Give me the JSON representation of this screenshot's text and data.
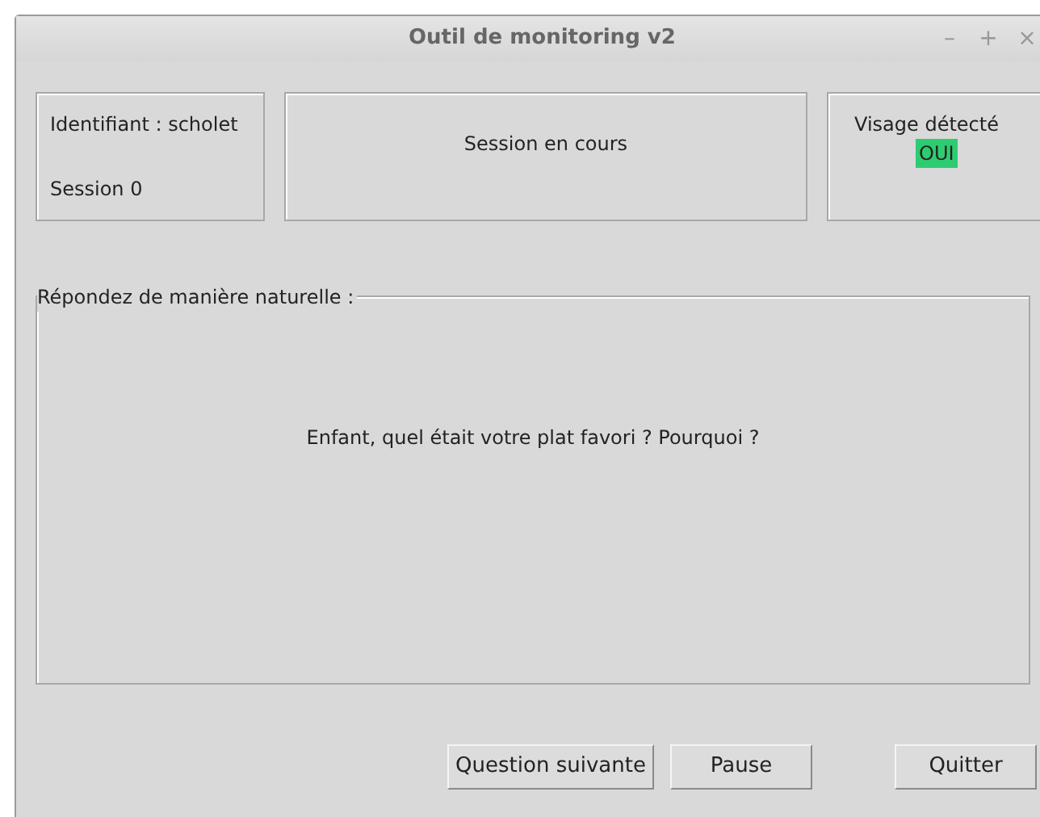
{
  "window": {
    "title": "Outil de monitoring v2",
    "controls": [
      "–",
      "+",
      "×"
    ]
  },
  "user_panel": {
    "identifier": "Identifiant : scholet",
    "session": "Session 0"
  },
  "status_panel": {
    "text": "Session en cours"
  },
  "face_panel": {
    "label": "Visage détecté",
    "value": "OUI",
    "detected": true
  },
  "question_group": {
    "legend": "Répondez de manière naturelle :",
    "question": "Enfant, quel était votre plat favori ? Pourquoi ?"
  },
  "buttons": [
    {
      "label": "Question suivante"
    },
    {
      "label": "Pause"
    },
    {
      "label": "Quitter"
    }
  ]
}
